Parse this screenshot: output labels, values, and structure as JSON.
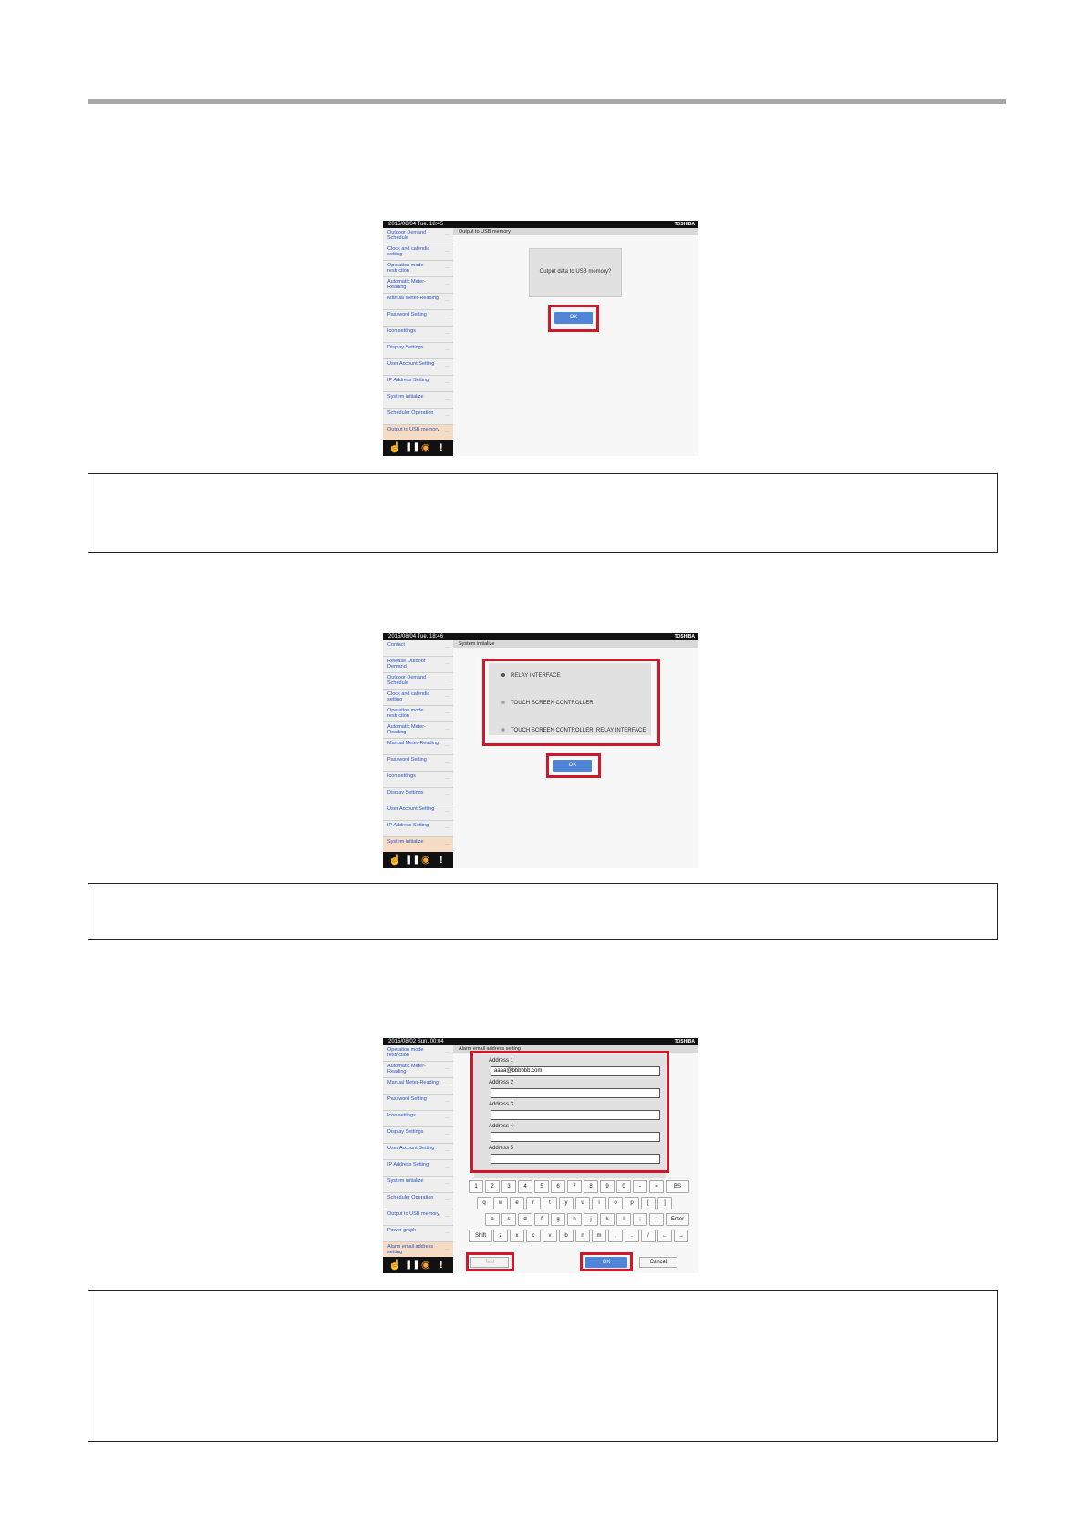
{
  "colors": {
    "rule": "#a6a6a6",
    "highlight": "#d0182b",
    "ok_button": "#4f84d6",
    "sidebar_active": "#f6dcc4",
    "sidebar_text": "#2b56c6"
  },
  "shot1": {
    "datetime": "2015/08/04  Tue. 18:45",
    "brand": "TOSHIBA",
    "header": "Output to USB memory",
    "sidebar": [
      "Outdoor Demand Schedule",
      "Clock and calendia setting",
      "Operation mode restriction",
      "Automatic Meter-Reading",
      "Manual Meter-Reading",
      "Password Setting",
      "Icon settings",
      "Display Settings",
      "User Account Setting",
      "IP Address Setting",
      "System initialize",
      "Scheduler Operation",
      "Output to USB memory"
    ],
    "dialog": "Output data to USB memory?",
    "ok": "OK"
  },
  "shot2": {
    "datetime": "2015/08/04  Tue. 18:46",
    "brand": "TOSHIBA",
    "header": "System initialize",
    "sidebar": [
      "Contact",
      "Release Outdoor Demand",
      "Outdoor Demand Schedule",
      "Clock and calendia setting",
      "Operation mode restriction",
      "Automatic Meter-Reading",
      "Manual Meter-Reading",
      "Password Setting",
      "Icon settings",
      "Display Settings",
      "User Account Setting",
      "IP Address Setting",
      "System initialize"
    ],
    "options": [
      "RELAY INTERFACE",
      "TOUCH SCREEN CONTROLLER",
      "TOUCH SCREEN CONTROLLER, RELAY INTERFACE"
    ],
    "ok": "OK"
  },
  "shot3": {
    "datetime": "2015/08/02  Sun. 00:04",
    "brand": "TOSHIBA",
    "header": "Alarm email address setting",
    "sidebar": [
      "Operation mode restriction",
      "Automatic Meter-Reading",
      "Manual Meter-Reading",
      "Password Setting",
      "Icon settings",
      "Display Settings",
      "User Account Setting",
      "IP Address Setting",
      "System initialize",
      "Scheduler Operation",
      "Output to USB memory",
      "Power graph",
      "Alarm email address setting"
    ],
    "addresses": [
      {
        "label": "Address 1",
        "value": "aaaa@bbbbbb.com"
      },
      {
        "label": "Address 2",
        "value": ""
      },
      {
        "label": "Address 3",
        "value": ""
      },
      {
        "label": "Address 4",
        "value": ""
      },
      {
        "label": "Address 5",
        "value": ""
      }
    ],
    "keyboard": {
      "row1": [
        "1",
        "2",
        "3",
        "4",
        "5",
        "6",
        "7",
        "8",
        "9",
        "0",
        "-",
        "=",
        "BS"
      ],
      "row2": [
        "q",
        "w",
        "e",
        "r",
        "t",
        "y",
        "u",
        "i",
        "o",
        "p",
        "[",
        "]"
      ],
      "row3": [
        "a",
        "s",
        "d",
        "f",
        "g",
        "h",
        "j",
        "k",
        "l",
        ";",
        "'",
        "Enter"
      ],
      "row4": [
        "Shift",
        "z",
        "x",
        "c",
        "v",
        "b",
        "n",
        "m",
        ",",
        ".",
        "/",
        "←",
        "→"
      ]
    },
    "test": "Test",
    "ok": "OK",
    "cancel": "Cancel"
  }
}
